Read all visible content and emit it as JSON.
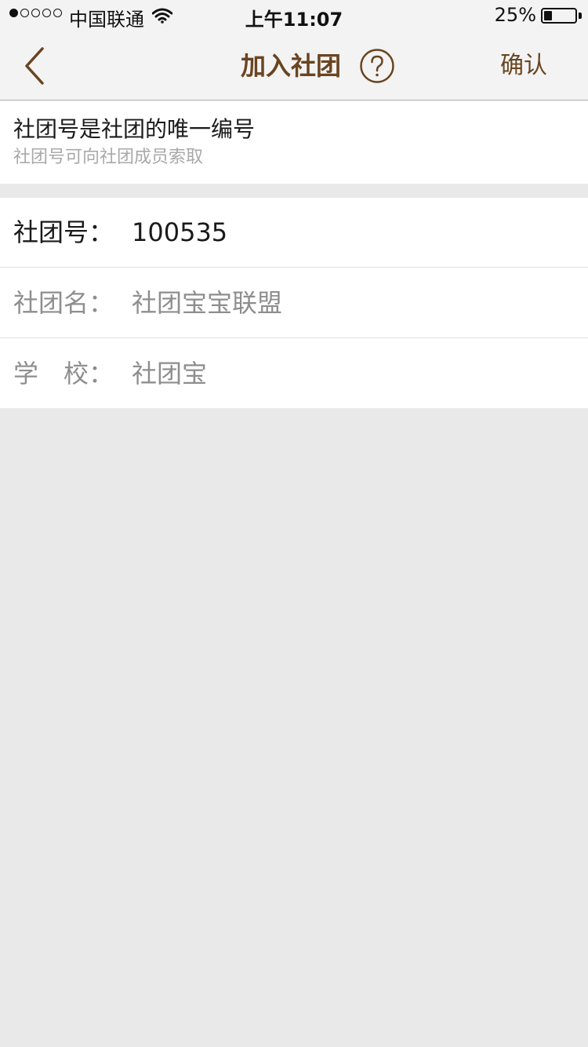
{
  "status_bar": {
    "carrier": "中国联通",
    "time": "上午11:07",
    "battery_percent": "25%",
    "battery_level": 0.25,
    "signal_strength": 1,
    "signal_icon": "signal-dots-icon",
    "wifi_icon": "wifi-icon",
    "battery_icon": "battery-icon"
  },
  "nav": {
    "back_icon": "chevron-left-icon",
    "title": "加入社团",
    "help_icon": "question-circle-icon",
    "confirm_label": "确认"
  },
  "info": {
    "title": "社团号是社团的唯一编号",
    "subtitle": "社团号可向社团成员索取"
  },
  "form": {
    "rows": [
      {
        "label": "社团号：",
        "value": "100535"
      },
      {
        "label": "社团名：",
        "value": "社团宝宝联盟"
      },
      {
        "label": "学　校：",
        "value": "社团宝"
      }
    ]
  },
  "colors": {
    "brand": "#6a4420",
    "background": "#e9e9e9",
    "nav_background": "#f3f3f3",
    "muted_text": "#8e8e8e",
    "hint_text": "#a9a9a9"
  }
}
